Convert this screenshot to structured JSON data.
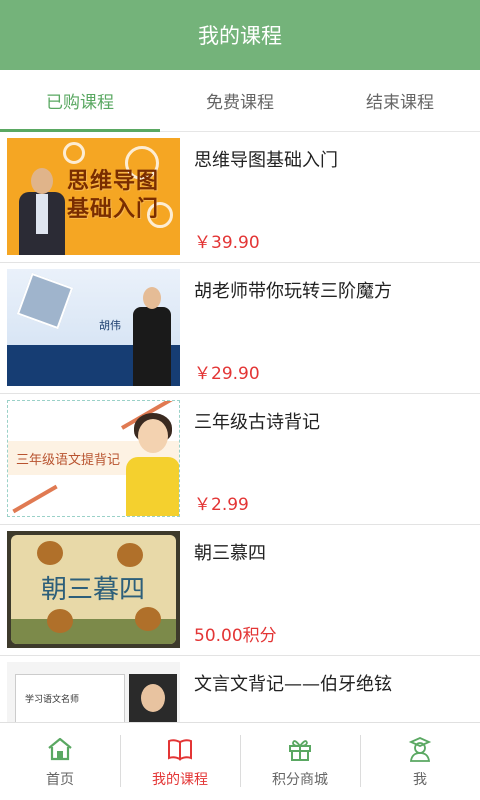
{
  "header": {
    "title": "我的课程"
  },
  "tabs": [
    {
      "label": "已购课程",
      "active": true
    },
    {
      "label": "免费课程",
      "active": false
    },
    {
      "label": "结束课程",
      "active": false
    }
  ],
  "courses": [
    {
      "title": "思维导图基础入门",
      "price": "￥39.90",
      "thumb_text_1": "思维导图",
      "thumb_text_2": "基础入门"
    },
    {
      "title": "胡老师带你玩转三阶魔方",
      "price": "￥29.90",
      "thumb_name": "胡伟"
    },
    {
      "title": "三年级古诗背记",
      "price": "￥2.99",
      "thumb_text": "三年级语文提背记"
    },
    {
      "title": "朝三慕四",
      "price": "50.00积分",
      "thumb_text": "朝三暮四"
    },
    {
      "title": "文言文背记——伯牙绝铉",
      "price": "",
      "thumb_text": "学习语文名师"
    }
  ],
  "bottom_nav": [
    {
      "label": "首页",
      "icon": "home-icon",
      "active": false
    },
    {
      "label": "我的课程",
      "icon": "book-icon",
      "active": true
    },
    {
      "label": "积分商城",
      "icon": "gift-icon",
      "active": false
    },
    {
      "label": "我",
      "icon": "profile-icon",
      "active": false
    }
  ],
  "colors": {
    "header_bg": "#74b37a",
    "accent_green": "#5aa862",
    "price_red": "#e33535",
    "nav_inactive": "#888888"
  }
}
